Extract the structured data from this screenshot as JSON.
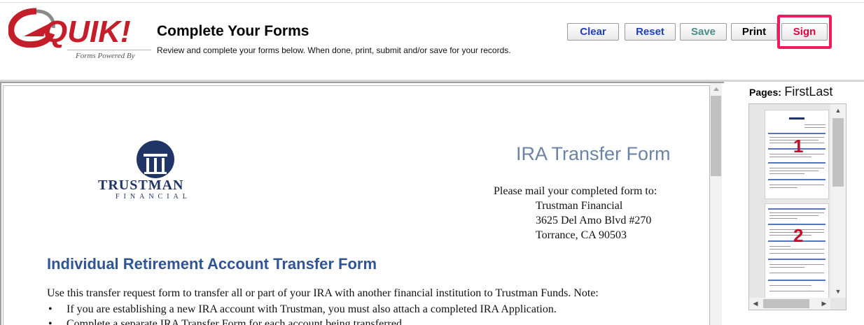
{
  "header": {
    "logo_text": "QUIK!",
    "logo_tagline": "Forms Powered By",
    "title": "Complete Your Forms",
    "subtitle": "Review and complete your forms below. When done, print, submit and/or save for your records."
  },
  "toolbar": {
    "clear_label": "Clear",
    "reset_label": "Reset",
    "save_label": "Save",
    "print_label": "Print",
    "sign_label": "Sign"
  },
  "colors": {
    "logo_red": "#c41e2a",
    "highlight": "#ee1c5a",
    "button_blue": "#1f3fb8",
    "save_teal": "#4a8c86",
    "sign_red": "#e0003c",
    "doc_heading_blue": "#2f5596"
  },
  "document": {
    "company_name": "TRUSTMAN",
    "company_sub": "FINANCIAL",
    "form_title": "IRA Transfer Form",
    "mail_label": "Please mail your completed form to:",
    "address": [
      "Trustman Financial",
      "3625 Del Amo Blvd #270",
      "Torrance, CA 90503"
    ],
    "section_title": "Individual Retirement Account Transfer Form",
    "intro": "Use this transfer request form to transfer all or part of your IRA with another financial institution to Trustman Funds. Note:",
    "bullets": [
      "If you are establishing a new IRA account with Trustman, you must also attach a completed IRA Application.",
      "Complete a separate IRA Transfer Form for each account being transferred."
    ]
  },
  "pages_panel": {
    "label": "Pages:",
    "first": "First",
    "last": "Last",
    "thumbnails": [
      "1",
      "2"
    ]
  }
}
